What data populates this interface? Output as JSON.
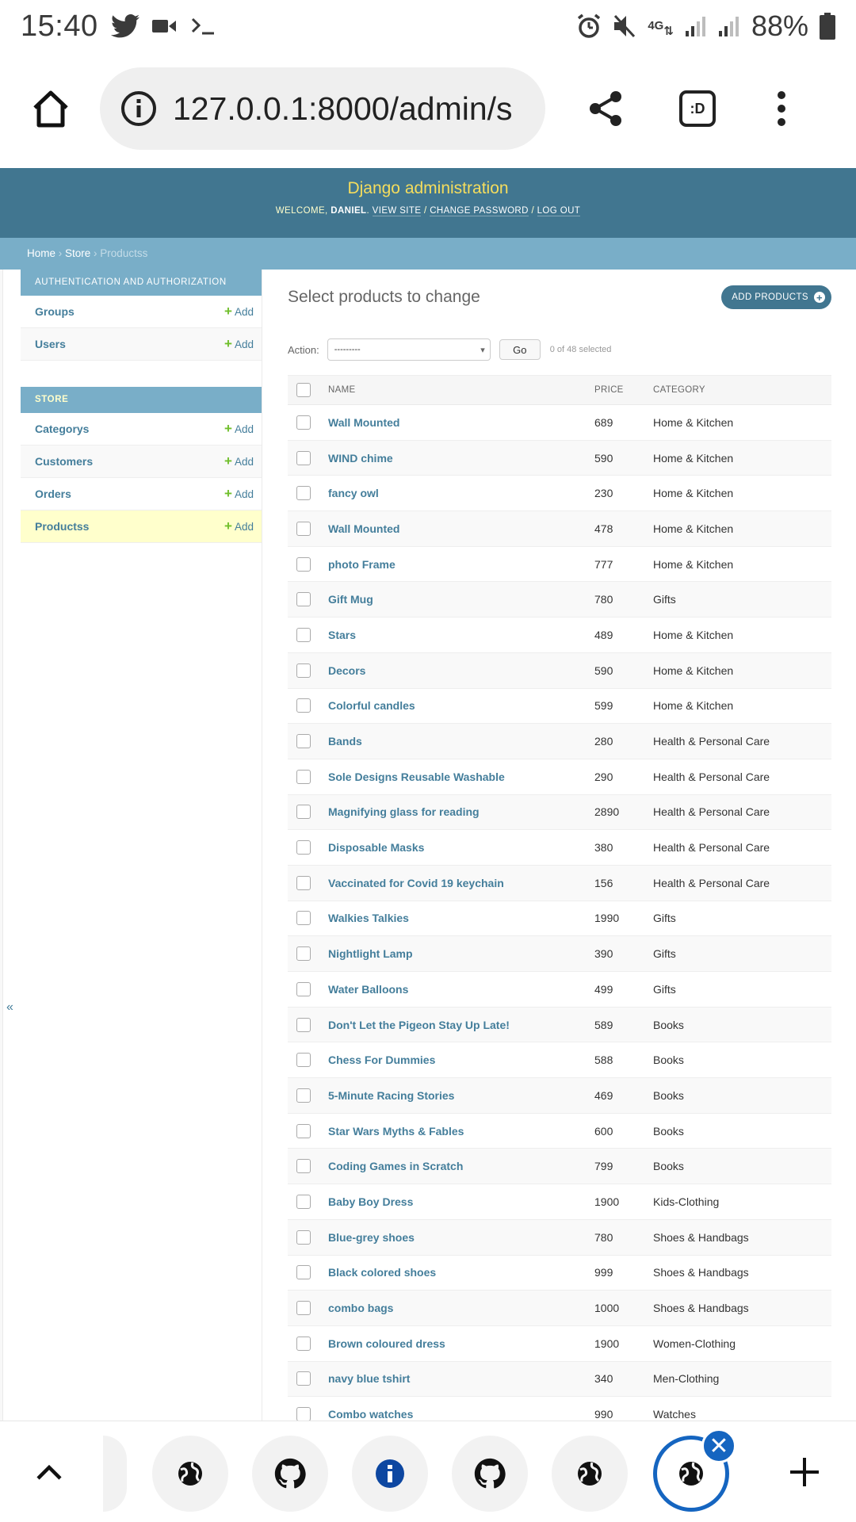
{
  "status_bar": {
    "time": "15:40",
    "battery": "88%",
    "network": "4G"
  },
  "browser": {
    "url": "127.0.0.1:8000/admin/s",
    "tab_switcher_label": ":D"
  },
  "header": {
    "brand": "Django administration",
    "welcome": "Welcome,",
    "user": "Daniel",
    "view_site": "View site",
    "change_password": "Change password",
    "log_out": "Log out"
  },
  "breadcrumbs": {
    "home": "Home",
    "store": "Store",
    "current": "Productss"
  },
  "sidebar": {
    "modules": [
      {
        "caption": "Authentication and Authorization",
        "items": [
          {
            "name": "Groups",
            "add": "Add"
          },
          {
            "name": "Users",
            "add": "Add"
          }
        ]
      },
      {
        "caption": "Store",
        "items": [
          {
            "name": "Categorys",
            "add": "Add"
          },
          {
            "name": "Customers",
            "add": "Add"
          },
          {
            "name": "Orders",
            "add": "Add"
          },
          {
            "name": "Productss",
            "add": "Add"
          }
        ]
      }
    ],
    "collapse_label": "«"
  },
  "content": {
    "title": "Select products to change",
    "add_button": "Add Products",
    "action_label": "Action:",
    "action_value": "---------",
    "go_label": "Go",
    "selected_count": "0 of 48 selected",
    "columns": {
      "name": "Name",
      "price": "Price",
      "category": "Category"
    },
    "rows": [
      {
        "name": "Wall Mounted",
        "price": "689",
        "category": "Home & Kitchen"
      },
      {
        "name": "WIND chime",
        "price": "590",
        "category": "Home & Kitchen"
      },
      {
        "name": "fancy owl",
        "price": "230",
        "category": "Home & Kitchen"
      },
      {
        "name": "Wall Mounted",
        "price": "478",
        "category": "Home & Kitchen"
      },
      {
        "name": "photo Frame",
        "price": "777",
        "category": "Home & Kitchen"
      },
      {
        "name": "Gift Mug",
        "price": "780",
        "category": "Gifts"
      },
      {
        "name": "Stars",
        "price": "489",
        "category": "Home & Kitchen"
      },
      {
        "name": "Decors",
        "price": "590",
        "category": "Home & Kitchen"
      },
      {
        "name": "Colorful candles",
        "price": "599",
        "category": "Home & Kitchen"
      },
      {
        "name": "Bands",
        "price": "280",
        "category": "Health & Personal Care"
      },
      {
        "name": "Sole Designs Reusable Washable",
        "price": "290",
        "category": "Health & Personal Care"
      },
      {
        "name": "Magnifying glass for reading",
        "price": "2890",
        "category": "Health & Personal Care"
      },
      {
        "name": "Disposable Masks",
        "price": "380",
        "category": "Health & Personal Care"
      },
      {
        "name": "Vaccinated for Covid 19 keychain",
        "price": "156",
        "category": "Health & Personal Care"
      },
      {
        "name": "Walkies Talkies",
        "price": "1990",
        "category": "Gifts"
      },
      {
        "name": "Nightlight Lamp",
        "price": "390",
        "category": "Gifts"
      },
      {
        "name": "Water Balloons",
        "price": "499",
        "category": "Gifts"
      },
      {
        "name": "Don't Let the Pigeon Stay Up Late!",
        "price": "589",
        "category": "Books"
      },
      {
        "name": "Chess For Dummies",
        "price": "588",
        "category": "Books"
      },
      {
        "name": "5-Minute Racing Stories",
        "price": "469",
        "category": "Books"
      },
      {
        "name": "Star Wars Myths & Fables",
        "price": "600",
        "category": "Books"
      },
      {
        "name": "Coding Games in Scratch",
        "price": "799",
        "category": "Books"
      },
      {
        "name": "Baby Boy Dress",
        "price": "1900",
        "category": "Kids-Clothing"
      },
      {
        "name": "Blue-grey shoes",
        "price": "780",
        "category": "Shoes & Handbags"
      },
      {
        "name": "Black colored shoes",
        "price": "999",
        "category": "Shoes & Handbags"
      },
      {
        "name": "combo bags",
        "price": "1000",
        "category": "Shoes & Handbags"
      },
      {
        "name": "Brown coloured dress",
        "price": "1900",
        "category": "Women-Clothing"
      },
      {
        "name": "navy blue tshirt",
        "price": "340",
        "category": "Men-Clothing"
      },
      {
        "name": "Combo watches",
        "price": "990",
        "category": "Watches"
      }
    ]
  },
  "bottom_tabs": [
    {
      "icon": "globe-icon"
    },
    {
      "icon": "github-icon"
    },
    {
      "icon": "info-icon"
    },
    {
      "icon": "github-icon"
    },
    {
      "icon": "globe-icon"
    },
    {
      "icon": "globe-icon",
      "active": true
    }
  ],
  "colors": {
    "header_bg": "#417690",
    "breadcrumb_bg": "#79aec8",
    "brand_yellow": "#f5dd5d",
    "link_blue": "#447e9b",
    "add_green": "#70bf2b",
    "selected_row": "#ffffcc",
    "active_tab_blue": "#1565c0"
  }
}
